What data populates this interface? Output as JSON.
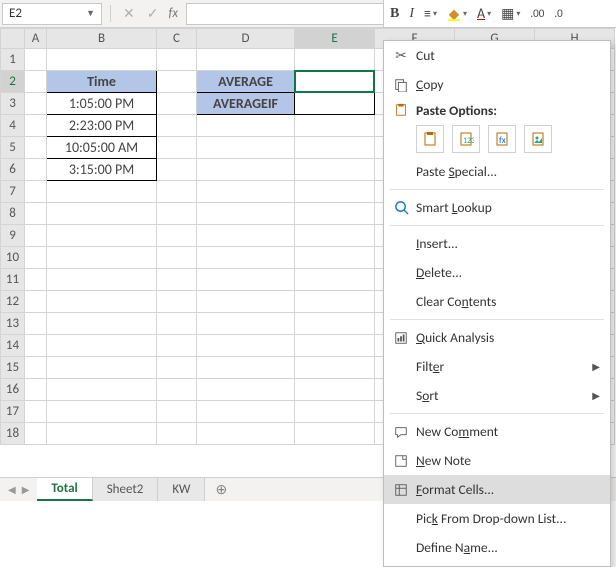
{
  "namebox": "E2",
  "formula_value": "",
  "columns": [
    "A",
    "B",
    "C",
    "D",
    "E",
    "F",
    "G",
    "H"
  ],
  "rows": [
    "1",
    "2",
    "3",
    "4",
    "5",
    "6",
    "7",
    "8",
    "9",
    "10",
    "11",
    "12",
    "13",
    "14",
    "15",
    "16",
    "17",
    "18"
  ],
  "cells": {
    "B2": "Time",
    "B3": "1:05:00 PM",
    "B4": "2:23:00 PM",
    "B5": "10:05:00 AM",
    "B6": "3:15:00 PM",
    "D2": "AVERAGE",
    "D3": "AVERAGEIF"
  },
  "mini_toolbar": {
    "bold": "B",
    "italic": "I"
  },
  "context_menu": {
    "cut": "Cut",
    "copy": "Copy",
    "paste_options_header": "Paste Options:",
    "paste_special": "Paste Special...",
    "smart_lookup": "Smart Lookup",
    "insert": "Insert...",
    "delete": "Delete...",
    "clear_contents": "Clear Contents",
    "quick_analysis": "Quick Analysis",
    "filter": "Filter",
    "sort": "Sort",
    "new_comment": "New Comment",
    "new_note": "New Note",
    "format_cells": "Format Cells...",
    "pick_from_list": "Pick From Drop-down List...",
    "define_name": "Define Name..."
  },
  "tabs": {
    "items": [
      "Total",
      "Sheet2",
      "KW"
    ],
    "active_index": 0
  }
}
